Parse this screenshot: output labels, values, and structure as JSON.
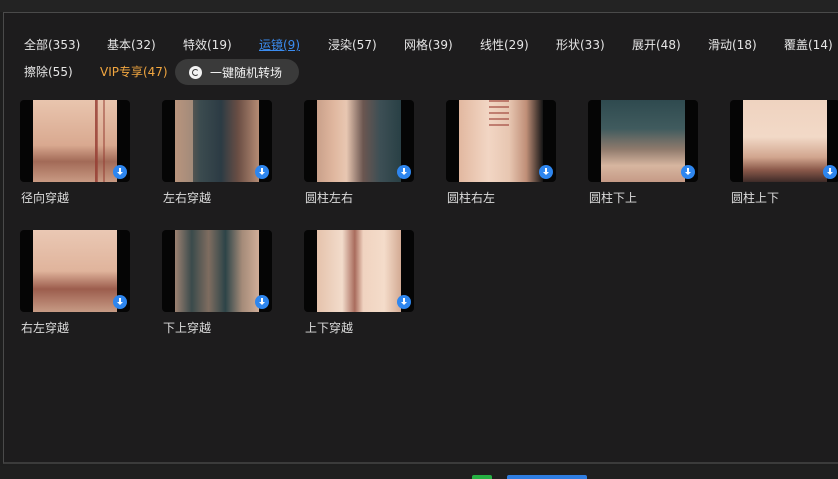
{
  "tabs": [
    {
      "label": "全部(353)"
    },
    {
      "label": "基本(32)"
    },
    {
      "label": "特效(19)"
    },
    {
      "label": "运镜(9)"
    },
    {
      "label": "浸染(57)"
    },
    {
      "label": "网格(39)"
    },
    {
      "label": "线性(29)"
    },
    {
      "label": "形状(33)"
    },
    {
      "label": "展开(48)"
    },
    {
      "label": "滑动(18)"
    },
    {
      "label": "覆盖(14)"
    },
    {
      "label": "擦除(55)"
    },
    {
      "label": "VIP专享(47)"
    }
  ],
  "active_tab": "运镜(9)",
  "random_button": {
    "label": "一键随机转场"
  },
  "transitions": [
    {
      "name": "径向穿越"
    },
    {
      "name": "左右穿越"
    },
    {
      "name": "圆柱左右"
    },
    {
      "name": "圆柱右左"
    },
    {
      "name": "圆柱下上"
    },
    {
      "name": "圆柱上下"
    },
    {
      "name": "右左穿越"
    },
    {
      "name": "下上穿越"
    },
    {
      "name": "上下穿越"
    }
  ],
  "colors": {
    "accent": "#3b8cf0",
    "vip": "#f1a640",
    "download_badge": "#2e86ef"
  },
  "icons": {
    "download": "download-icon",
    "random": "shuffle-icon"
  }
}
